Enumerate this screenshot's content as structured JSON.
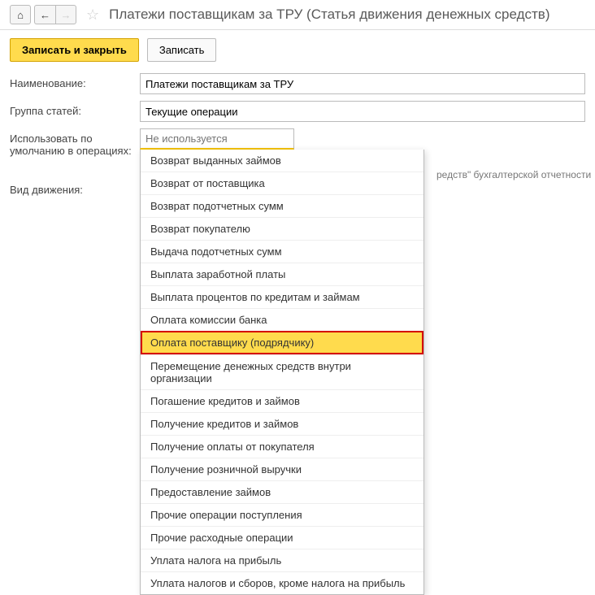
{
  "toolbar": {
    "home_icon": "⌂",
    "back_icon": "←",
    "forward_icon": "→",
    "star_icon": "☆"
  },
  "page_title": "Платежи поставщикам за ТРУ (Статья движения денежных средств)",
  "actions": {
    "save_close": "Записать и закрыть",
    "save": "Записать"
  },
  "form": {
    "name_label": "Наименование:",
    "name_value": "Платежи поставщикам за ТРУ",
    "group_label": "Группа статей:",
    "group_value": "Текущие операции",
    "default_ops_label": "Использовать по умолчанию в операциях:",
    "default_ops_placeholder": "Не используется",
    "movement_type_label": "Вид движения:",
    "side_hint": "редств\" бухгалтерской отчетности"
  },
  "dropdown": {
    "items": [
      "Возврат выданных займов",
      "Возврат от поставщика",
      "Возврат подотчетных сумм",
      "Возврат покупателю",
      "Выдача подотчетных сумм",
      "Выплата заработной платы",
      "Выплата процентов по кредитам и займам",
      "Оплата комиссии банка",
      "Оплата поставщику (подрядчику)",
      "Перемещение денежных средств внутри организации",
      "Погашение кредитов и займов",
      "Получение кредитов и займов",
      "Получение оплаты от покупателя",
      "Получение розничной выручки",
      "Предоставление займов",
      "Прочие операции поступления",
      "Прочие расходные операции",
      "Уплата налога на прибыль",
      "Уплата налогов и сборов, кроме налога на прибыль"
    ],
    "highlighted_index": 8
  }
}
